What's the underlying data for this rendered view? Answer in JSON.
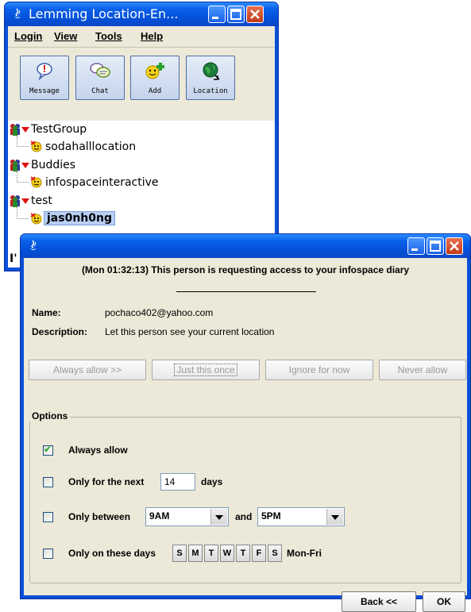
{
  "main_window": {
    "title": "Lemming Location-En...",
    "menu": [
      "Login",
      "View",
      "Tools",
      "Help"
    ],
    "toolbar": [
      {
        "label": "Message",
        "icon": "message-bubble-icon"
      },
      {
        "label": "Chat",
        "icon": "chat-bubbles-icon"
      },
      {
        "label": "Add",
        "icon": "add-contact-icon"
      },
      {
        "label": "Location",
        "icon": "globe-icon"
      }
    ],
    "tree": {
      "groups": [
        {
          "name": "TestGroup",
          "members": [
            "sodahalllocation"
          ]
        },
        {
          "name": "Buddies",
          "members": [
            "infospaceinteractive"
          ]
        },
        {
          "name": "test",
          "members": [
            "jas0nh0ng"
          ]
        }
      ],
      "selected": "jas0nh0ng",
      "partial_text": "I'"
    }
  },
  "request_dialog": {
    "message": "(Mon 01:32:13) This person is requesting access to your infospace diary",
    "name_label": "Name:",
    "name_value": "pochaco402@yahoo.com",
    "description_label": "Description:",
    "description_value": "Let this person see your current location",
    "action_buttons": [
      "Always allow >>",
      "Just this once",
      "Ignore for now",
      "Never allow"
    ],
    "options_title": "Options",
    "options": {
      "always_allow": {
        "label": "Always allow",
        "checked": true
      },
      "only_next": {
        "label": "Only for the next",
        "value": "14",
        "suffix": "days",
        "checked": false
      },
      "only_between": {
        "label": "Only between",
        "from": "9AM",
        "and": "and",
        "to": "5PM",
        "checked": false
      },
      "only_days": {
        "label": "Only on these days",
        "days": [
          "S",
          "M",
          "T",
          "W",
          "T",
          "F",
          "S"
        ],
        "suffix": "Mon-Fri",
        "checked": false
      }
    },
    "back_button": "Back <<",
    "ok_button": "OK"
  }
}
